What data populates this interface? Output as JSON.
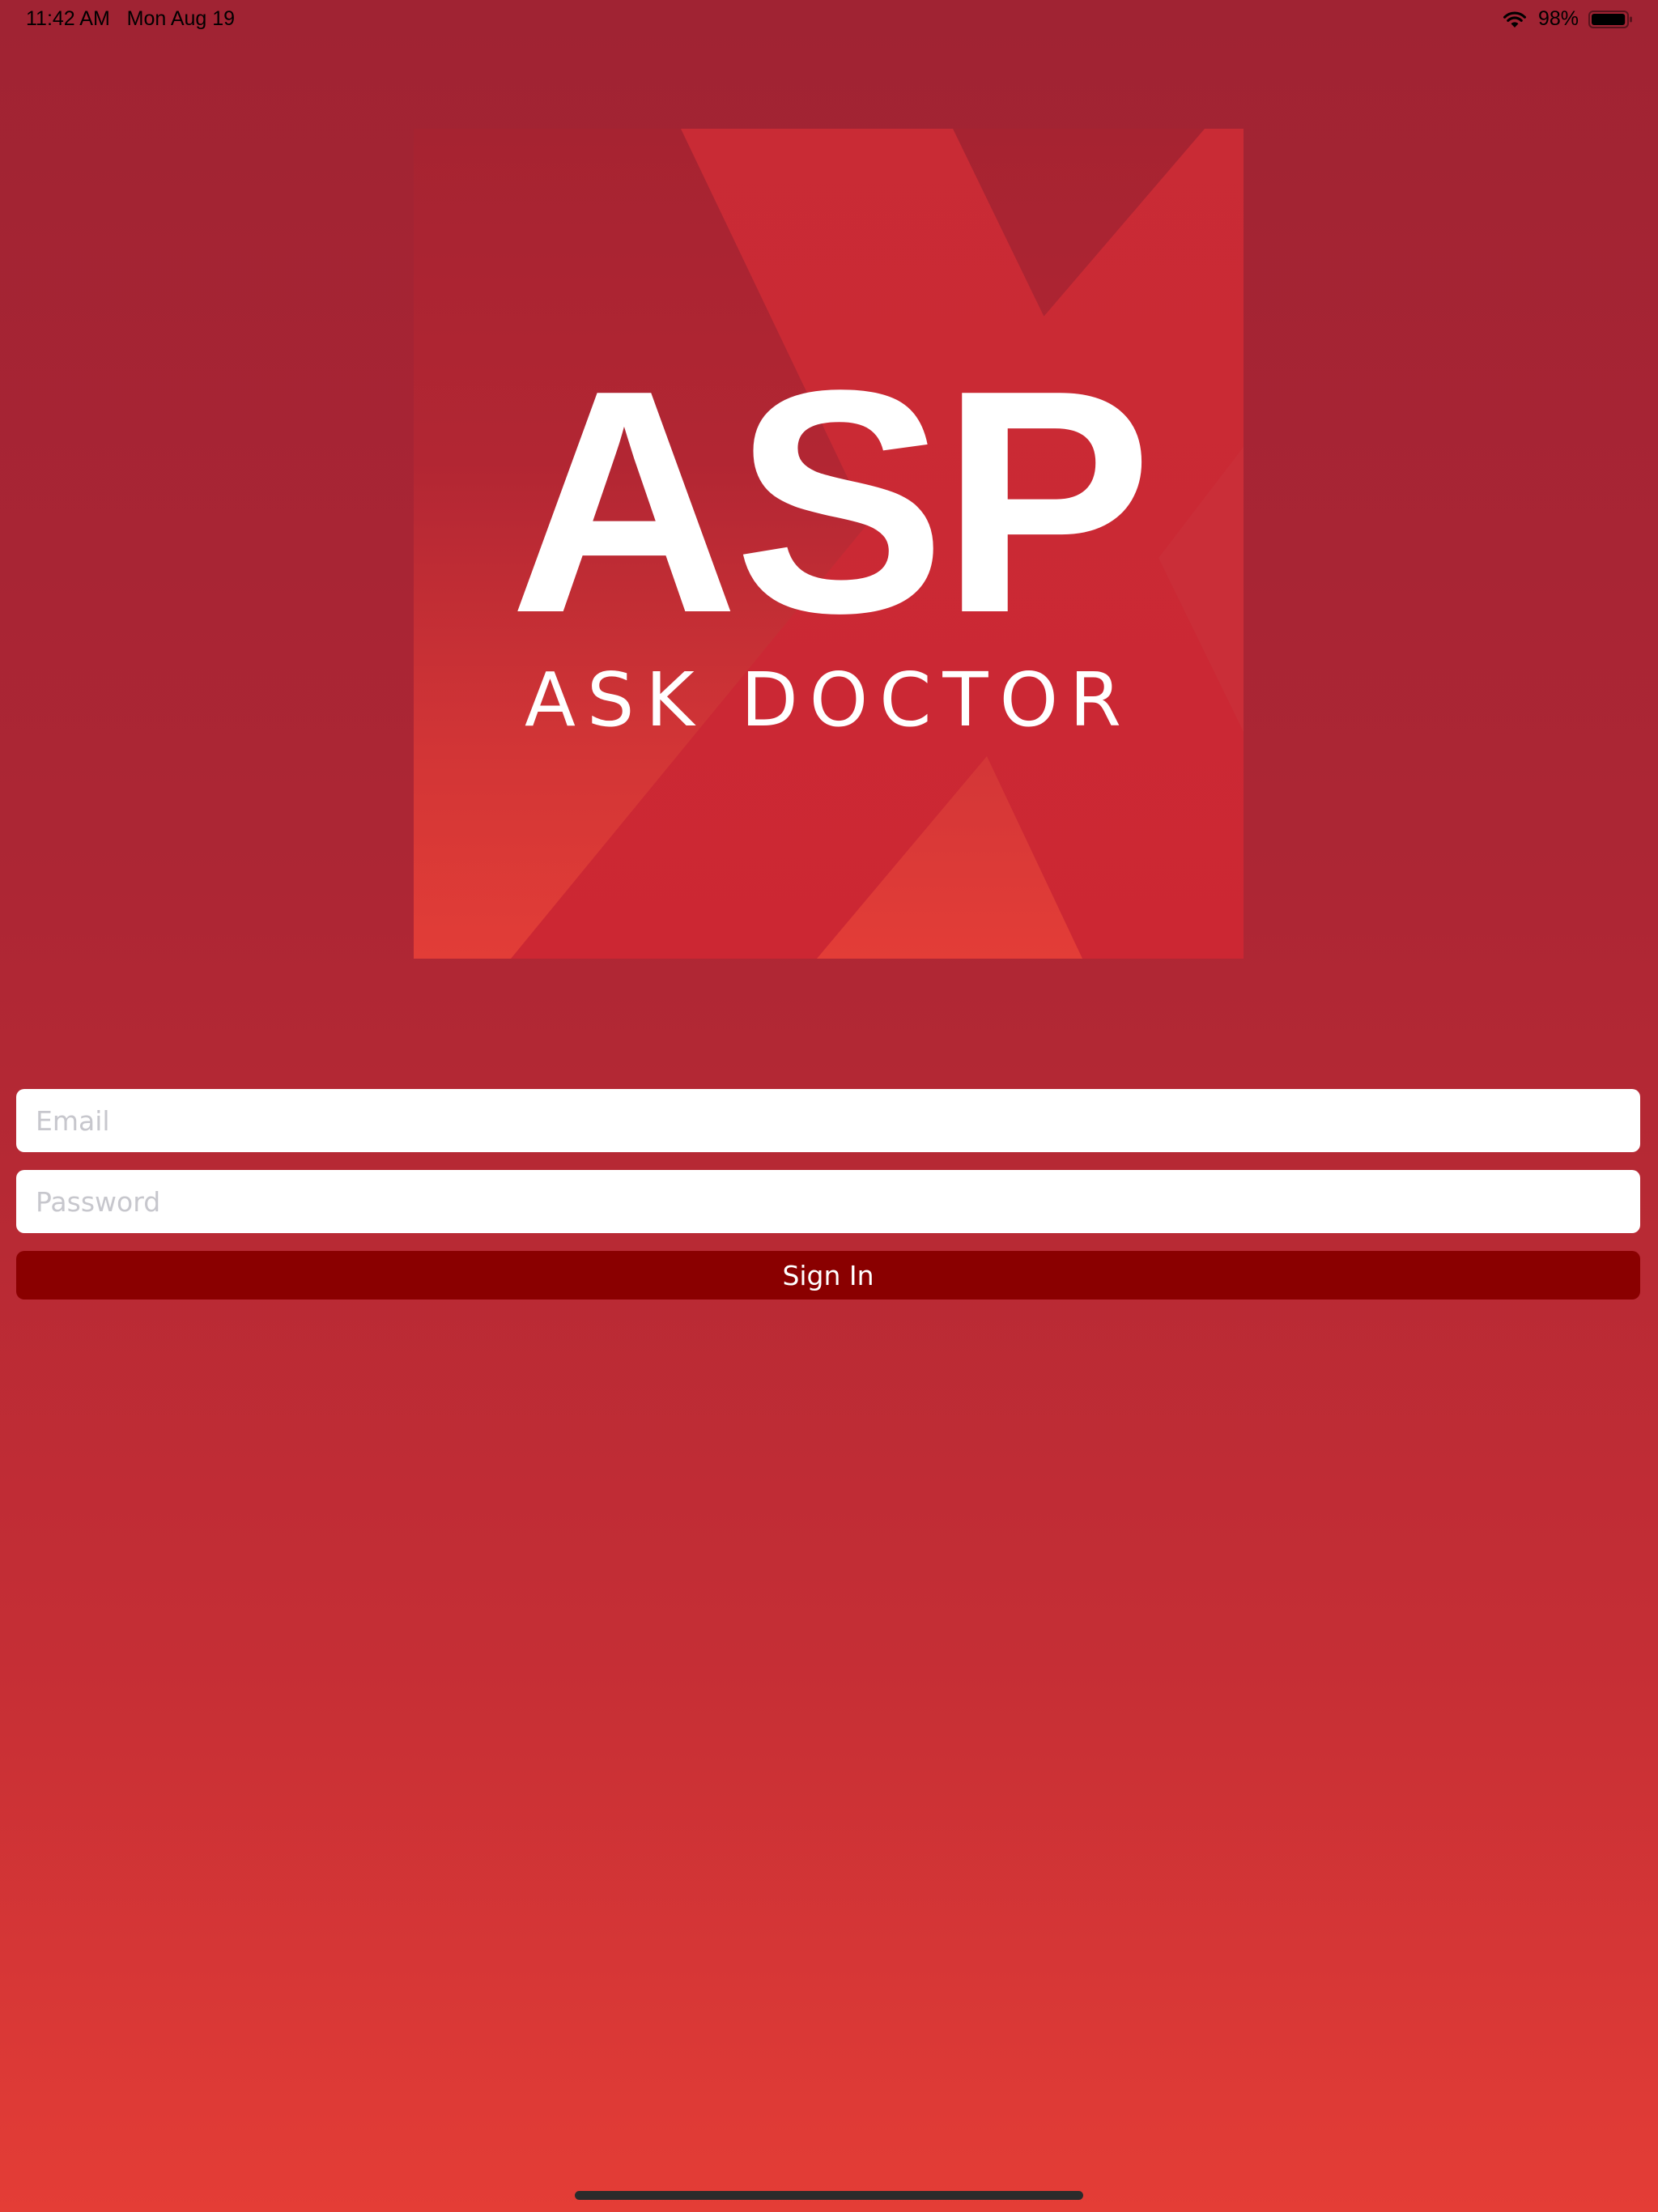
{
  "status_bar": {
    "time": "11:42 AM",
    "date": "Mon Aug 19",
    "battery_text": "98%",
    "battery_level": 0.98,
    "wifi_icon": "wifi-icon",
    "battery_icon": "battery-icon"
  },
  "logo": {
    "title": "ASP",
    "subtitle": "ASK DOCTOR"
  },
  "form": {
    "email_placeholder": "Email",
    "email_value": "",
    "password_placeholder": "Password",
    "password_value": "",
    "signin_label": "Sign In"
  },
  "colors": {
    "background_top": "#a02333",
    "background_bottom": "#e43d36",
    "button": "#8a0000",
    "input": "#ffffff",
    "placeholder": "#c7c7cd"
  }
}
